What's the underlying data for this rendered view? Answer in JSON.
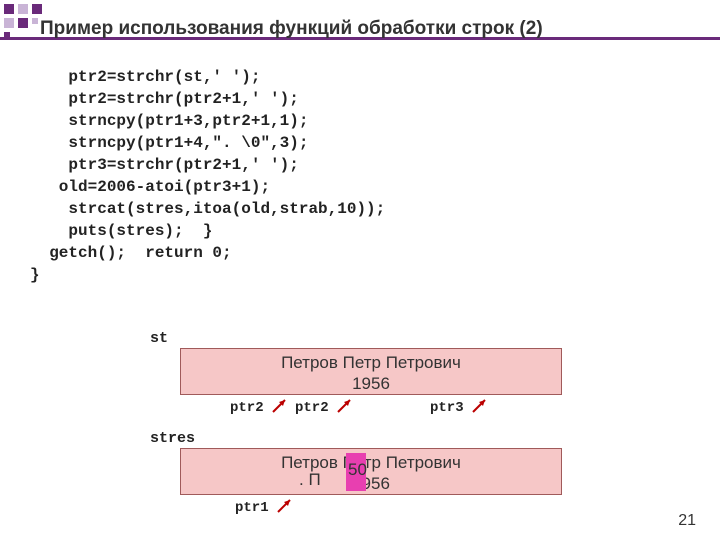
{
  "title": "Пример использования функций обработки строк (2)",
  "code": "    ptr2=strchr(st,' ');\n    ptr2=strchr(ptr2+1,' ');\n    strncpy(ptr1+3,ptr2+1,1);\n    strncpy(ptr1+4,\". \\0\",3);\n    ptr3=strchr(ptr2+1,' ');\n   old=2006-atoi(ptr3+1);\n    strcat(stres,itoa(old,strab,10));\n    puts(stres);  }\n  getch();  return 0;\n}",
  "diagram": {
    "st_label": "st",
    "st_box_line1": "Петров  Петр  Петрович",
    "st_box_line2": "1956",
    "ptr2a": "ptr2",
    "ptr2b": "ptr2",
    "ptr3": "ptr3",
    "stres_label": "stres",
    "stres_box_line1": "Петров  Петр  Петрович",
    "stres_box_line2": "1956",
    "stres_overlay_dot": ". П",
    "stres_overlay_num": "50",
    "ptr1": "ptr1"
  },
  "pagenum": "21"
}
